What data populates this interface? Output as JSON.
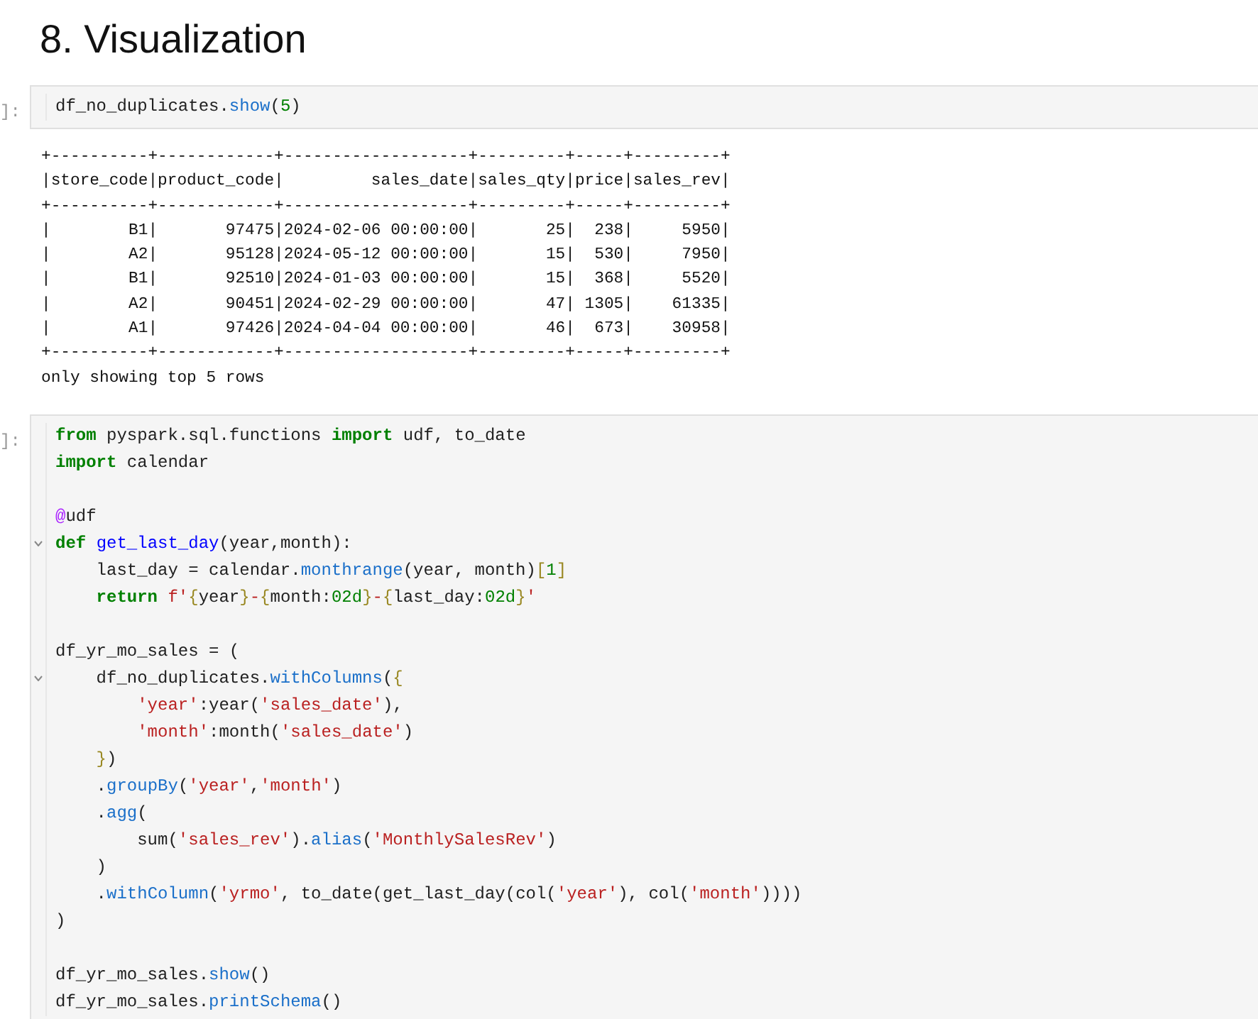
{
  "heading": "8. Visualization",
  "cells": [
    {
      "prompt": "]:",
      "blocks": [
        [
          {
            "tokens": [
              {
                "kind": "plain",
                "s": "df_no_duplicates."
              },
              {
                "kind": "fn",
                "s": "show"
              },
              {
                "kind": "plain",
                "s": "("
              },
              {
                "kind": "num",
                "s": "5"
              },
              {
                "kind": "plain",
                "s": ")"
              }
            ]
          }
        ]
      ],
      "output": [
        "+----------+------------+-------------------+---------+-----+---------+",
        "|store_code|product_code|         sales_date|sales_qty|price|sales_rev|",
        "+----------+------------+-------------------+---------+-----+---------+",
        "|        B1|       97475|2024-02-06 00:00:00|       25|  238|     5950|",
        "|        A2|       95128|2024-05-12 00:00:00|       15|  530|     7950|",
        "|        B1|       92510|2024-01-03 00:00:00|       15|  368|     5520|",
        "|        A2|       90451|2024-02-29 00:00:00|       47| 1305|    61335|",
        "|        A1|       97426|2024-04-04 00:00:00|       46|  673|    30958|",
        "+----------+------------+-------------------+---------+-----+---------+",
        "only showing top 5 rows"
      ]
    },
    {
      "prompt": "]:",
      "blocks": [
        [
          {
            "tokens": [
              {
                "kind": "kw",
                "s": "from"
              },
              {
                "kind": "plain",
                "s": " pyspark.sql.functions "
              },
              {
                "kind": "kw",
                "s": "import"
              },
              {
                "kind": "plain",
                "s": " udf, to_date"
              }
            ]
          },
          {
            "tokens": [
              {
                "kind": "kw",
                "s": "import"
              },
              {
                "kind": "plain",
                "s": " calendar"
              }
            ]
          }
        ],
        [
          {
            "tokens": [
              {
                "kind": "deco",
                "s": "@"
              },
              {
                "kind": "plain",
                "s": "udf"
              }
            ]
          },
          {
            "fold": true,
            "tokens": [
              {
                "kind": "kw",
                "s": "def "
              },
              {
                "kind": "def",
                "s": "get_last_day"
              },
              {
                "kind": "plain",
                "s": "(year,month):"
              }
            ]
          },
          {
            "tokens": [
              {
                "kind": "plain",
                "s": "    last_day = calendar."
              },
              {
                "kind": "fn",
                "s": "monthrange"
              },
              {
                "kind": "plain",
                "s": "(year, month)"
              },
              {
                "kind": "brace",
                "s": "["
              },
              {
                "kind": "num",
                "s": "1"
              },
              {
                "kind": "brace",
                "s": "]"
              }
            ]
          },
          {
            "tokens": [
              {
                "kind": "kw",
                "s": "    return "
              },
              {
                "kind": "str",
                "s": "f'"
              },
              {
                "kind": "brace",
                "s": "{"
              },
              {
                "kind": "plain",
                "s": "year"
              },
              {
                "kind": "brace",
                "s": "}"
              },
              {
                "kind": "str",
                "s": "-"
              },
              {
                "kind": "brace",
                "s": "{"
              },
              {
                "kind": "plain",
                "s": "month:"
              },
              {
                "kind": "num",
                "s": "02d"
              },
              {
                "kind": "brace",
                "s": "}"
              },
              {
                "kind": "str",
                "s": "-"
              },
              {
                "kind": "brace",
                "s": "{"
              },
              {
                "kind": "plain",
                "s": "last_day:"
              },
              {
                "kind": "num",
                "s": "02d"
              },
              {
                "kind": "brace",
                "s": "}"
              },
              {
                "kind": "str",
                "s": "'"
              }
            ]
          }
        ],
        [
          {
            "tokens": [
              {
                "kind": "plain",
                "s": "df_yr_mo_sales = ("
              }
            ]
          },
          {
            "fold": true,
            "tokens": [
              {
                "kind": "plain",
                "s": "    df_no_duplicates."
              },
              {
                "kind": "fn",
                "s": "withColumns"
              },
              {
                "kind": "plain",
                "s": "("
              },
              {
                "kind": "brace",
                "s": "{"
              }
            ]
          },
          {
            "tokens": [
              {
                "kind": "str",
                "s": "        'year'"
              },
              {
                "kind": "plain",
                "s": ":year("
              },
              {
                "kind": "str",
                "s": "'sales_date'"
              },
              {
                "kind": "plain",
                "s": "),"
              }
            ]
          },
          {
            "tokens": [
              {
                "kind": "str",
                "s": "        'month'"
              },
              {
                "kind": "plain",
                "s": ":month("
              },
              {
                "kind": "str",
                "s": "'sales_date'"
              },
              {
                "kind": "plain",
                "s": ")"
              }
            ]
          },
          {
            "tokens": [
              {
                "kind": "brace",
                "s": "    }"
              },
              {
                "kind": "plain",
                "s": ")"
              }
            ]
          },
          {
            "tokens": [
              {
                "kind": "plain",
                "s": "    ."
              },
              {
                "kind": "fn",
                "s": "groupBy"
              },
              {
                "kind": "plain",
                "s": "("
              },
              {
                "kind": "str",
                "s": "'year'"
              },
              {
                "kind": "plain",
                "s": ","
              },
              {
                "kind": "str",
                "s": "'month'"
              },
              {
                "kind": "plain",
                "s": ")"
              }
            ]
          },
          {
            "tokens": [
              {
                "kind": "plain",
                "s": "    ."
              },
              {
                "kind": "fn",
                "s": "agg"
              },
              {
                "kind": "plain",
                "s": "("
              }
            ]
          },
          {
            "tokens": [
              {
                "kind": "plain",
                "s": "        sum("
              },
              {
                "kind": "str",
                "s": "'sales_rev'"
              },
              {
                "kind": "plain",
                "s": ")."
              },
              {
                "kind": "fn",
                "s": "alias"
              },
              {
                "kind": "plain",
                "s": "("
              },
              {
                "kind": "str",
                "s": "'MonthlySalesRev'"
              },
              {
                "kind": "plain",
                "s": ")"
              }
            ]
          },
          {
            "tokens": [
              {
                "kind": "plain",
                "s": "    )"
              }
            ]
          },
          {
            "tokens": [
              {
                "kind": "plain",
                "s": "    ."
              },
              {
                "kind": "fn",
                "s": "withColumn"
              },
              {
                "kind": "plain",
                "s": "("
              },
              {
                "kind": "str",
                "s": "'yrmo'"
              },
              {
                "kind": "plain",
                "s": ", to_date(get_last_day(col("
              },
              {
                "kind": "str",
                "s": "'year'"
              },
              {
                "kind": "plain",
                "s": "), col("
              },
              {
                "kind": "str",
                "s": "'month'"
              },
              {
                "kind": "plain",
                "s": "))))"
              }
            ]
          },
          {
            "tokens": [
              {
                "kind": "plain",
                "s": ")"
              }
            ]
          }
        ],
        [
          {
            "tokens": [
              {
                "kind": "plain",
                "s": "df_yr_mo_sales."
              },
              {
                "kind": "fn",
                "s": "show"
              },
              {
                "kind": "plain",
                "s": "()"
              }
            ]
          },
          {
            "tokens": [
              {
                "kind": "plain",
                "s": "df_yr_mo_sales."
              },
              {
                "kind": "fn",
                "s": "printSchema"
              },
              {
                "kind": "plain",
                "s": "()"
              }
            ]
          }
        ]
      ]
    }
  ]
}
